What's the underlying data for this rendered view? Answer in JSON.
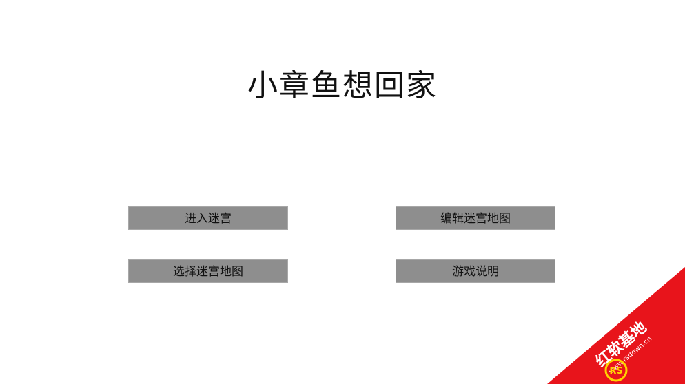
{
  "title": "小章鱼想回家",
  "buttons": {
    "enter_maze": "进入迷宫",
    "edit_maze_map": "编辑迷宫地图",
    "select_maze_map": "选择迷宫地图",
    "game_help": "游戏说明"
  },
  "watermark": {
    "brand_text": "红软基地",
    "url_text": "www.rsdown.cn",
    "logo_text": "RS",
    "color": "#e8141b",
    "accent_color": "#ffd200"
  }
}
